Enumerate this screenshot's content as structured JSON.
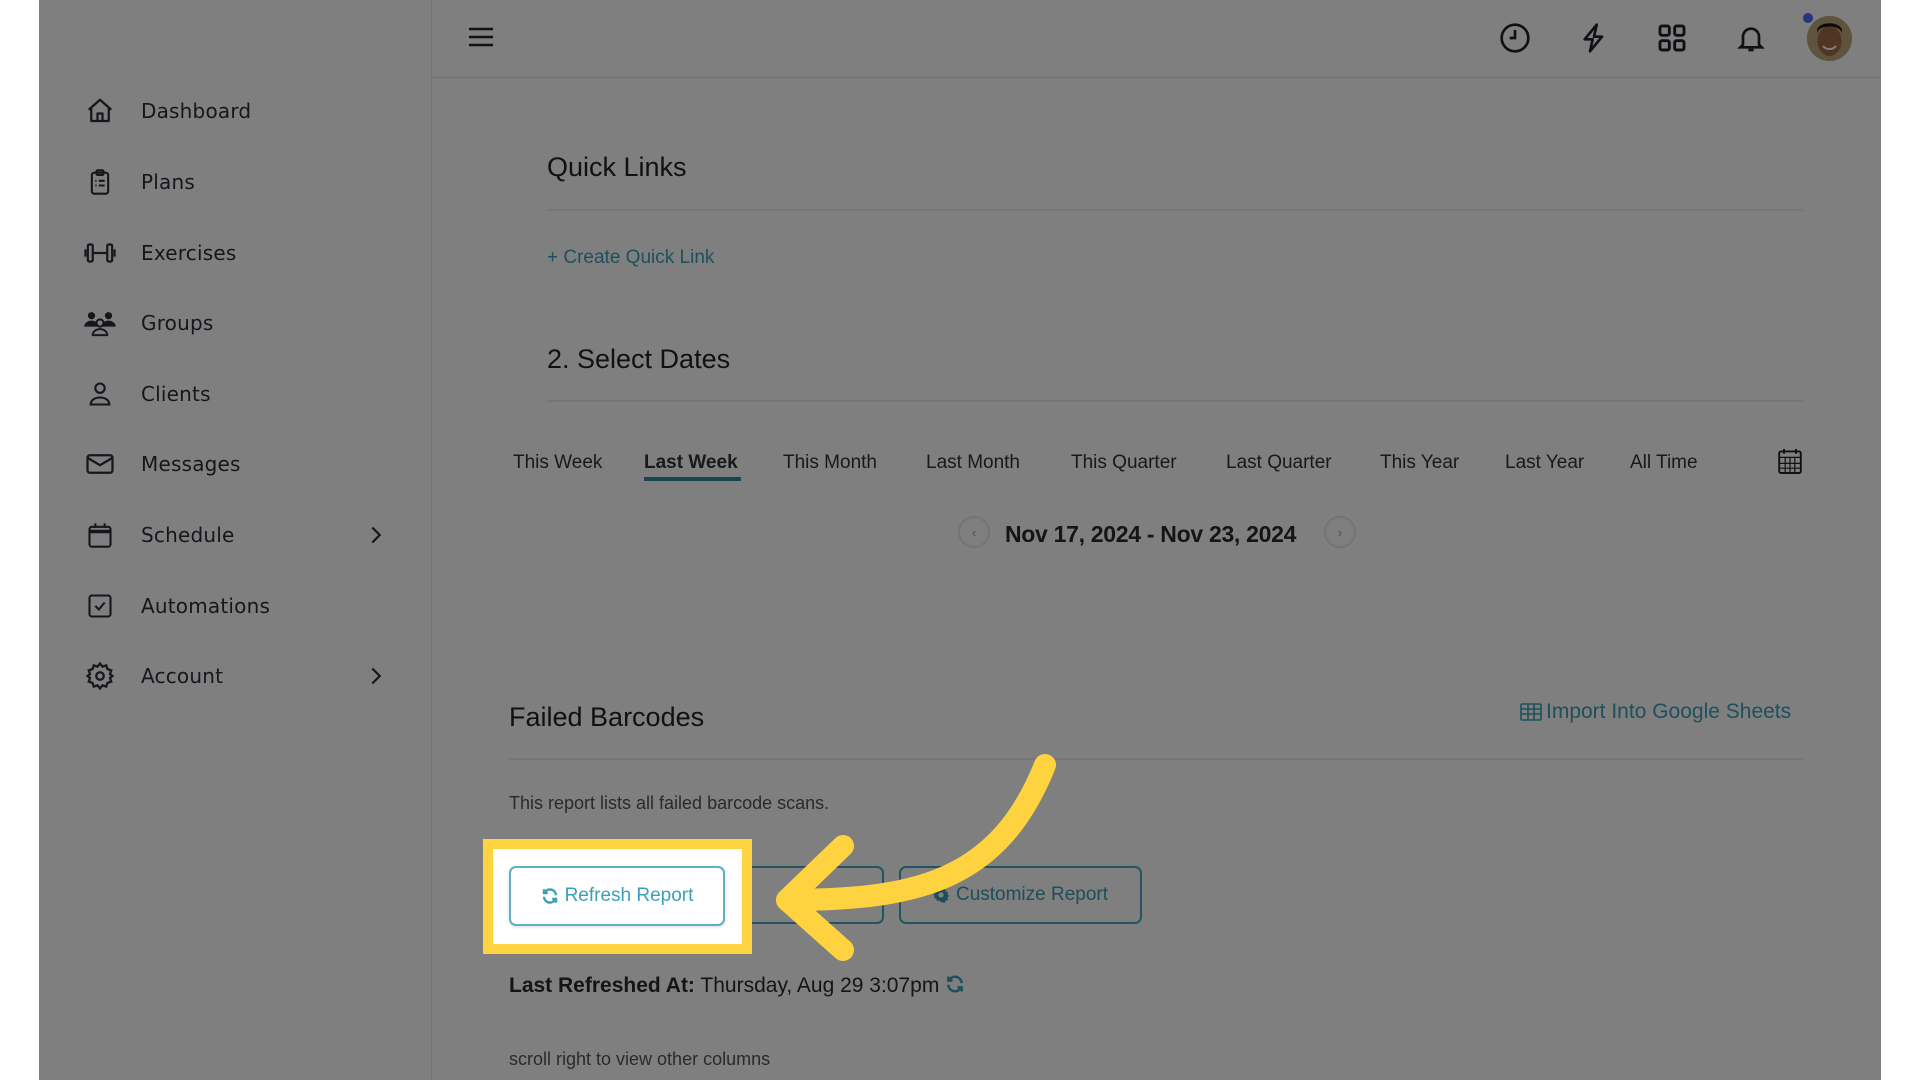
{
  "sidebar": {
    "items": [
      {
        "label": "Dashboard",
        "icon": "home-icon",
        "has_submenu": false
      },
      {
        "label": "Plans",
        "icon": "clipboard-icon",
        "has_submenu": false
      },
      {
        "label": "Exercises",
        "icon": "dumbbell-icon",
        "has_submenu": false
      },
      {
        "label": "Groups",
        "icon": "users-icon",
        "has_submenu": false
      },
      {
        "label": "Clients",
        "icon": "user-icon",
        "has_submenu": false
      },
      {
        "label": "Messages",
        "icon": "envelope-icon",
        "has_submenu": false
      },
      {
        "label": "Schedule",
        "icon": "calendar-icon",
        "has_submenu": true
      },
      {
        "label": "Automations",
        "icon": "checkbox-icon",
        "has_submenu": false
      },
      {
        "label": "Account",
        "icon": "gear-icon",
        "has_submenu": true
      }
    ]
  },
  "header": {
    "icons": [
      "menu-icon",
      "clock-icon",
      "lightning-icon",
      "apps-grid-icon",
      "bell-icon"
    ],
    "notification_dot_color": "#4a6cf7"
  },
  "quick_links": {
    "title": "Quick Links",
    "create_link": "+ Create Quick Link"
  },
  "select_dates": {
    "title": "2. Select Dates",
    "tabs": [
      "This Week",
      "Last Week",
      "This Month",
      "Last Month",
      "This Quarter",
      "Last Quarter",
      "This Year",
      "Last Year",
      "All Time"
    ],
    "active_tab": "Last Week",
    "range_label": "Nov 17, 2024 - Nov 23, 2024"
  },
  "report": {
    "title": "Failed Barcodes",
    "import_link": "Import Into Google Sheets",
    "description": "This report lists all failed barcode scans.",
    "buttons": {
      "refresh": "Refresh Report",
      "customize": "Customize Report"
    },
    "last_refreshed_label": "Last Refreshed At:",
    "last_refreshed_value": "Thursday, Aug 29 3:07pm",
    "scroll_hint": "scroll right to view other columns"
  },
  "colors": {
    "accent": "#3aa1b8",
    "highlight": "#ffd23f"
  }
}
